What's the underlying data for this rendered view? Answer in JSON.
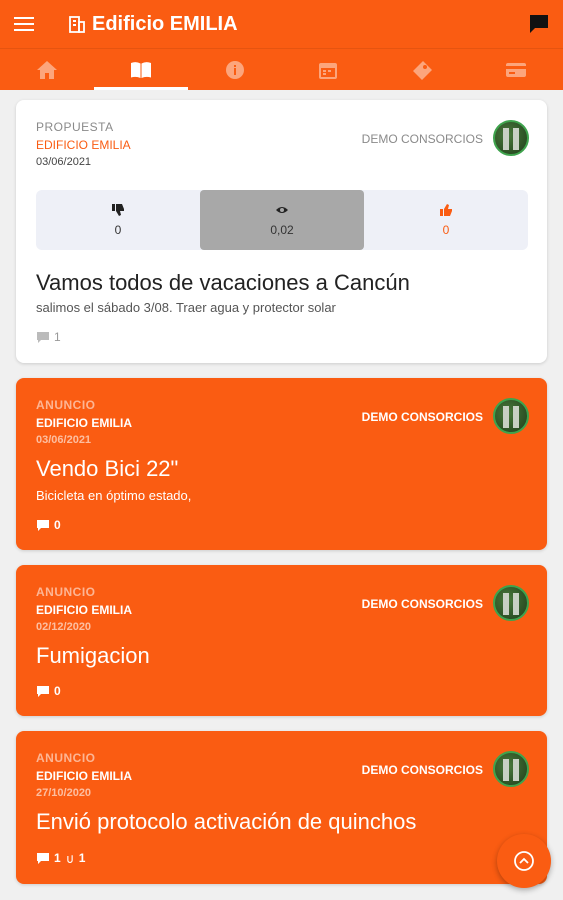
{
  "app": {
    "title": "Edificio EMILIA"
  },
  "colors": {
    "accent": "#fa5c12",
    "selected_vote": "#a8a8a8"
  },
  "tabs": [
    {
      "name": "home-icon",
      "active": false
    },
    {
      "name": "book-icon",
      "active": true
    },
    {
      "name": "info-icon",
      "active": false
    },
    {
      "name": "calendar-icon",
      "active": false
    },
    {
      "name": "ticket-icon",
      "active": false
    },
    {
      "name": "card-icon",
      "active": false
    }
  ],
  "posts": [
    {
      "type": "PROPUESTA",
      "building": "EDIFICIO EMILIA",
      "date": "03/06/2021",
      "author": "DEMO CONSORCIOS",
      "votes": {
        "down": "0",
        "neutral": "0,02",
        "up": "0"
      },
      "title": "Vamos todos de vacaciones a Cancún",
      "description": "salimos el sábado 3/08. Traer agua y protector solar",
      "comments": "1"
    },
    {
      "type": "ANUNCIO",
      "building": "EDIFICIO EMILIA",
      "date": "03/06/2021",
      "author": "DEMO CONSORCIOS",
      "title": "Vendo Bici 22\"",
      "description": "Bicicleta en óptimo estado,",
      "comments": "0"
    },
    {
      "type": "ANUNCIO",
      "building": "EDIFICIO EMILIA",
      "date": "02/12/2020",
      "author": "DEMO CONSORCIOS",
      "title": "Fumigacion",
      "comments": "0"
    },
    {
      "type": "ANUNCIO",
      "building": "EDIFICIO EMILIA",
      "date": "27/10/2020",
      "author": "DEMO CONSORCIOS",
      "title": "Envió protocolo activación de quinchos",
      "comments": "1",
      "attachments": "1"
    }
  ]
}
